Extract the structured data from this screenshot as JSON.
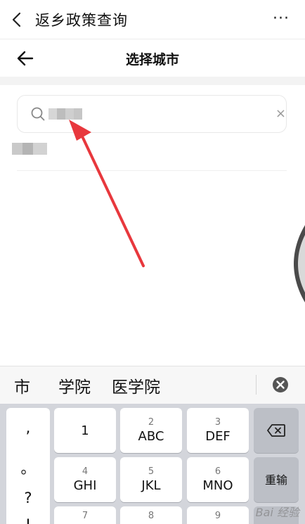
{
  "topbar": {
    "title": "返乡政策查询",
    "more_label": "···"
  },
  "header": {
    "title": "选择城市"
  },
  "search": {
    "placeholder": ""
  },
  "candidates": [
    "市",
    "学院",
    "医学院"
  ],
  "keyboard": {
    "punctuation": [
      ",",
      "。",
      "?",
      "!"
    ],
    "keys": [
      {
        "num": "",
        "letters": "1"
      },
      {
        "num": "2",
        "letters": "ABC"
      },
      {
        "num": "3",
        "letters": "DEF"
      },
      {
        "num": "4",
        "letters": "GHI"
      },
      {
        "num": "5",
        "letters": "JKL"
      },
      {
        "num": "6",
        "letters": "MNO"
      },
      {
        "num": "7",
        "letters": ""
      },
      {
        "num": "8",
        "letters": ""
      },
      {
        "num": "9",
        "letters": ""
      }
    ],
    "retype_label": "重输"
  },
  "watermark": "Bai 经验",
  "colors": {
    "arrow": "#e8383d",
    "keyboard_bg": "#d3d5db"
  }
}
